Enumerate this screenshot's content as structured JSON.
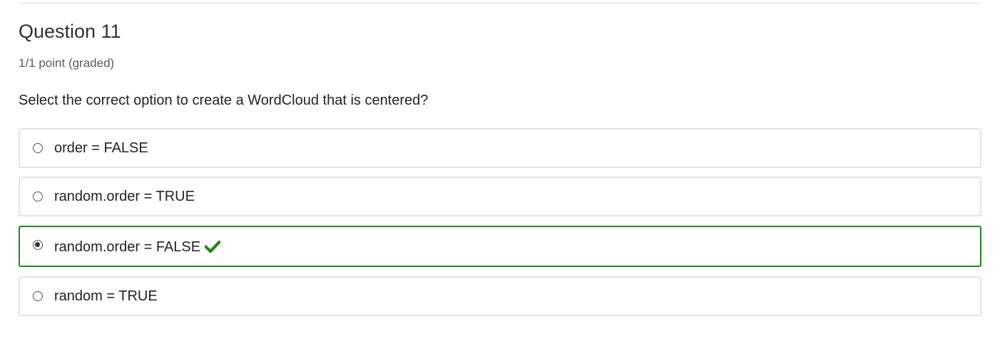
{
  "problem": {
    "title": "Question 11",
    "progress": "1/1 point (graded)",
    "question": "Select the correct option to create a WordCloud that is centered?",
    "choices": [
      {
        "label": "order = FALSE",
        "selected": false,
        "correct": false
      },
      {
        "label": "random.order = TRUE",
        "selected": false,
        "correct": false
      },
      {
        "label": "random.order = FALSE",
        "selected": true,
        "correct": true,
        "status_icon": "check-icon"
      },
      {
        "label": "random = TRUE",
        "selected": false,
        "correct": false
      }
    ]
  },
  "colors": {
    "correct": "#1e8a1e",
    "border": "#e4e4e4",
    "text": "#222222"
  }
}
